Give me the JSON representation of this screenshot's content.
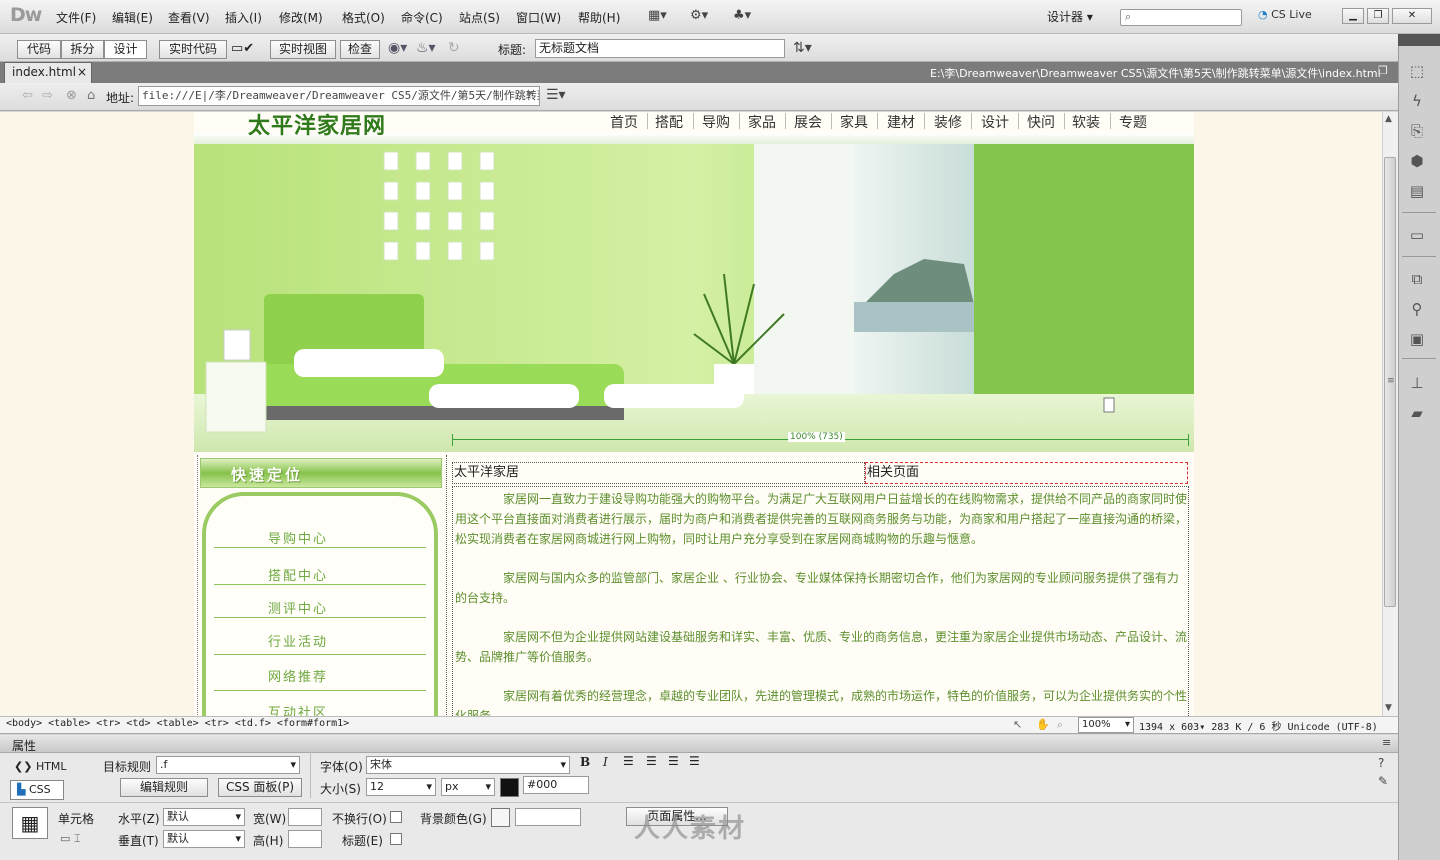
{
  "app": {
    "logo": "Dw",
    "designer": "设计器 ▾",
    "cs_live": "CS Live",
    "search_placeholder": ""
  },
  "menu": [
    "文件(F)",
    "编辑(E)",
    "查看(V)",
    "插入(I)",
    "修改(M)",
    "格式(O)",
    "命令(C)",
    "站点(S)",
    "窗口(W)",
    "帮助(H)"
  ],
  "doc_toolbar": {
    "code": "代码",
    "split": "拆分",
    "design": "设计",
    "live_code": "实时代码",
    "live_view": "实时视图",
    "inspect": "检查",
    "title_label": "标题:",
    "title_value": "无标题文档"
  },
  "tab": {
    "name": "index.html",
    "close": "×",
    "path": "E:\\李\\Dreamweaver\\Dreamweaver CS5\\源文件\\第5天\\制作跳转菜单\\源文件\\index.html"
  },
  "address": {
    "label": "地址:",
    "value": "file:///E|/李/Dreamweaver/Dreamweaver CS5/源文件/第5天/制作跳转菜"
  },
  "site": {
    "logo": "太平洋家居网",
    "nav": [
      "首页",
      "搭配",
      "导购",
      "家品",
      "展会",
      "家具",
      "建材",
      "装修",
      "设计",
      "快问",
      "软装",
      "专题"
    ],
    "sidebar_title": "快速定位",
    "sidebar_items": [
      "导购中心",
      "搭配中心",
      "测评中心",
      "行业活动",
      "网络推荐",
      "互动社区"
    ],
    "width_readout": "100% (735)",
    "cell_left": "太平洋家居",
    "cell_right": "相关页面",
    "paragraphs": [
      "家居网一直致力于建设导购功能强大的购物平台。为满足广大互联网用户日益增长的在线购物需求，提供给不同产品的商家同时使用这个平台直接面对消费者进行展示，届时为商户和消费者提供完善的互联网商务服务与功能，为商家和用户搭起了一座直接沟通的桥梁，松实现消费者在家居网商城进行网上购物，同时让用户充分享受到在家居网商城购物的乐趣与惬意。",
      "家居网与国内众多的监管部门、家居企业 、行业协会、专业媒体保持长期密切合作，他们为家居网的专业顾问服务提供了强有力的台支持。",
      "家居网不但为企业提供网站建设基础服务和详实、丰富、优质、专业的商务信息，更注重为家居企业提供市场动态、产品设计、流势、品牌推广等价值服务。",
      "家居网有着优秀的经营理念，卓越的专业团队，先进的管理模式，成熟的市场运作，特色的价值服务，可以为企业提供务实的个性化服务。"
    ]
  },
  "status": {
    "tag_path": "<body> <table> <tr> <td> <table> <tr> <td.f> <form#form1>",
    "zoom": "100%",
    "info": "1394 x 603▾  283 K / 6 秒  Unicode (UTF-8)"
  },
  "properties": {
    "title": "属性",
    "html": "HTML",
    "css": "CSS",
    "target_rule_label": "目标规则",
    "target_rule": ".f",
    "edit_rule": "编辑规则",
    "css_panel": "CSS 面板(P)",
    "font_label": "字体(O)",
    "font": "宋体",
    "size_label": "大小(S)",
    "size": "12",
    "unit": "px",
    "color": "#000",
    "cell": "单元格",
    "horz_label": "水平(Z)",
    "horz": "默认",
    "vert_label": "垂直(T)",
    "vert": "默认",
    "width_label": "宽(W)",
    "height_label": "高(H)",
    "nowrap": "不换行(O)",
    "header": "标题(E)",
    "bg_label": "背景颜色(G)",
    "page_props": "页面属性..."
  },
  "watermark": "人人素材",
  "colors": {
    "accent": "#7fbf3f",
    "text_green": "#5d8f2d"
  }
}
